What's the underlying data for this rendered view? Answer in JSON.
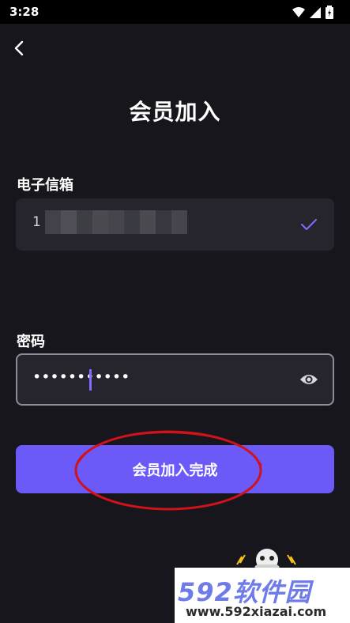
{
  "status_bar": {
    "time": "3:28",
    "icons": [
      "wifi-icon",
      "signal-icon",
      "battery-icon"
    ]
  },
  "header": {
    "back_icon": "chevron-left-icon",
    "title": "会员加入"
  },
  "email": {
    "label": "电子信箱",
    "value_visible": "1",
    "value_obscured": true,
    "status_icon": "check-icon"
  },
  "password": {
    "label": "密码",
    "masked_value": "•••••••••••",
    "toggle_icon": "eye-icon"
  },
  "submit": {
    "label": "会员加入完成"
  },
  "watermark": {
    "title": "592软件园",
    "url": "www.592xiazai.com"
  },
  "colors": {
    "background": "#17161c",
    "field": "#26252d",
    "accent": "#6b5af8",
    "annotation": "#d0121b"
  }
}
